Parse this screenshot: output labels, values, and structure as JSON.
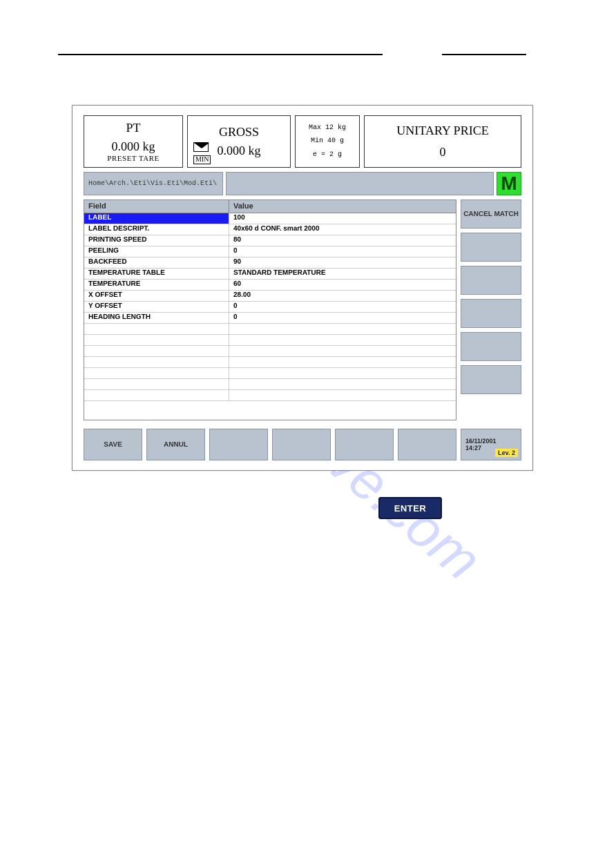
{
  "watermark": "manualshive.com",
  "top": {
    "pt_title": "PT",
    "pt_value": "0.000 kg",
    "pt_sub": "PRESET TARE",
    "gross_title": "GROSS",
    "gross_value": "0.000 kg",
    "min_label": "MIN",
    "minmax": {
      "max": "Max 12 kg",
      "min": "Min 40 g",
      "e": "e = 2 g"
    },
    "uprice_title": "UNITARY PRICE",
    "uprice_value": "0"
  },
  "path": "Home\\Arch.\\Eti\\Vis.Eti\\Mod.Eti\\",
  "m_button": "M",
  "table": {
    "head_field": "Field",
    "head_value": "Value",
    "rows": [
      {
        "field": "LABEL",
        "value": "100",
        "selected": true
      },
      {
        "field": "LABEL DESCRIPT.",
        "value": "40x60 d CONF. smart 2000"
      },
      {
        "field": "PRINTING SPEED",
        "value": "80"
      },
      {
        "field": "PEELING",
        "value": "0"
      },
      {
        "field": "BACKFEED",
        "value": "90"
      },
      {
        "field": "TEMPERATURE TABLE",
        "value": "STANDARD TEMPERATURE"
      },
      {
        "field": "TEMPERATURE",
        "value": "60"
      },
      {
        "field": "X OFFSET",
        "value": "28.00"
      },
      {
        "field": "Y OFFSET",
        "value": "0"
      },
      {
        "field": "HEADING LENGTH",
        "value": "0"
      },
      {
        "field": "",
        "value": ""
      },
      {
        "field": "",
        "value": ""
      },
      {
        "field": "",
        "value": ""
      },
      {
        "field": "",
        "value": ""
      },
      {
        "field": "",
        "value": ""
      },
      {
        "field": "",
        "value": ""
      },
      {
        "field": "",
        "value": ""
      }
    ]
  },
  "side_buttons": [
    "CANCEL MATCH",
    "",
    "",
    "",
    "",
    ""
  ],
  "bottom_buttons": [
    "SAVE",
    "ANNUL",
    "",
    "",
    "",
    ""
  ],
  "status": {
    "date": "16/11/2001",
    "time": "14:27",
    "lev": "Lev. 2"
  },
  "enter": "ENTER"
}
